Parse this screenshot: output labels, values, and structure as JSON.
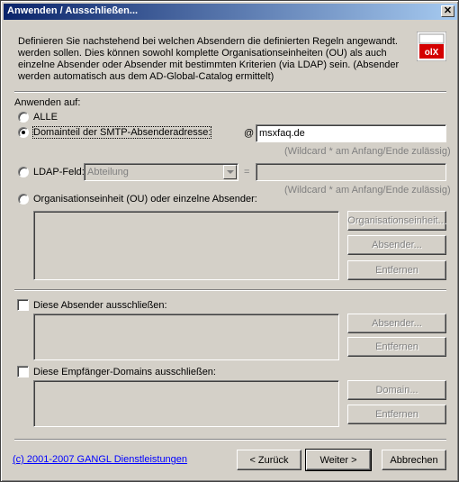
{
  "window": {
    "title": "Anwenden / Ausschließen..."
  },
  "description": "Definieren Sie nachstehend bei welchen Absendern die definierten Regeln angewandt. werden sollen. Dies können sowohl komplette Organisationseinheiten (OU) als auch einzelne Absender oder Absender mit bestimmten Kriterien (via LDAP) sein. (Absender werden automatisch aus dem AD-Global-Catalog ermittelt)",
  "logo": {
    "text": "olX"
  },
  "apply": {
    "heading": "Anwenden auf:",
    "options": {
      "all": "ALLE",
      "domain": "Domainteil der SMTP-Absenderadresse:",
      "ldap": "LDAP-Feld:",
      "ou": "Organisationseinheit (OU) oder einzelne Absender:"
    },
    "selected": "domain",
    "at_sign": "@",
    "domain_value": "msxfaq.de",
    "wildcard_hint": "(Wildcard * am Anfang/Ende zulässig)",
    "ldap_field_value": "Abteilung",
    "equals_sign": "=",
    "ldap_value": "",
    "buttons": {
      "ou": "Organisationseinheit...",
      "sender": "Absender...",
      "remove": "Entfernen"
    }
  },
  "exclude_senders": {
    "label": "Diese Absender ausschließen:",
    "checked": false,
    "buttons": {
      "sender": "Absender...",
      "remove": "Entfernen"
    }
  },
  "exclude_domains": {
    "label": "Diese Empfänger-Domains ausschließen:",
    "checked": false,
    "buttons": {
      "domain": "Domain...",
      "remove": "Entfernen"
    }
  },
  "footer": {
    "copyright": "(c) 2001-2007 GANGL Dienstleistungen",
    "back": "< Zurück",
    "next": "Weiter >",
    "cancel": "Abbrechen"
  }
}
